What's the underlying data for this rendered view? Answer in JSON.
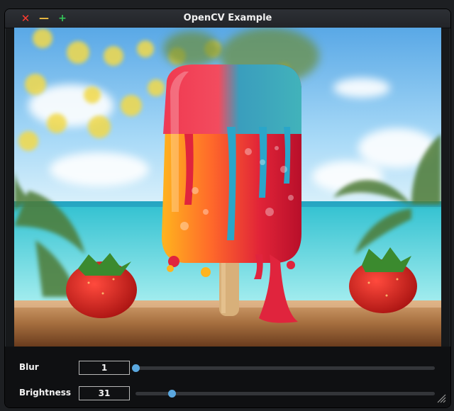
{
  "window": {
    "title": "OpenCV Example",
    "close_glyph": "✕",
    "minimize_glyph": "—",
    "maximize_glyph": "+"
  },
  "image": {
    "description_icon": "photo-icon"
  },
  "controls": {
    "blur": {
      "label": "Blur",
      "value": "1",
      "slider_fraction": 0.0
    },
    "brightness": {
      "label": "Brightness",
      "value": "31",
      "slider_fraction": 0.12
    }
  },
  "colors": {
    "accent": "#5aa7df",
    "close": "#ff3b30",
    "minimize": "#f6c343",
    "maximize": "#34c759"
  }
}
